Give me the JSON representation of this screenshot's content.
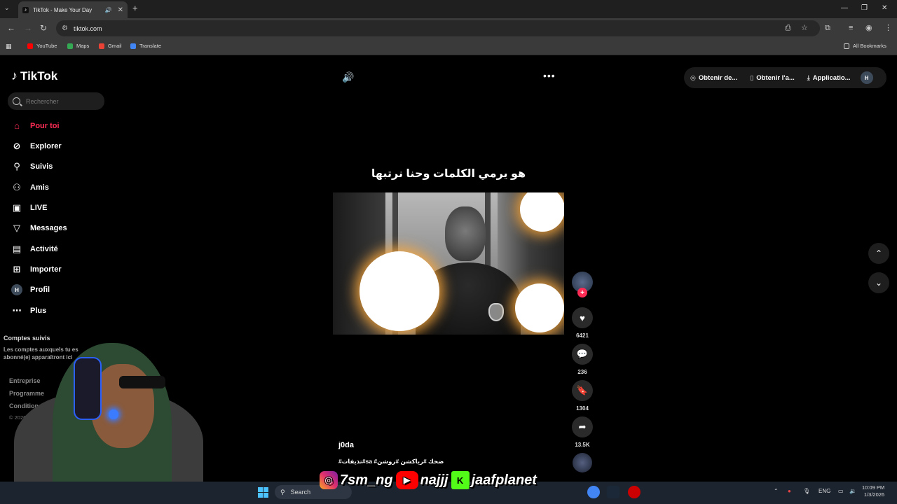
{
  "browser": {
    "tab_title": "TikTok - Make Your Day",
    "url": "tiktok.com",
    "bookmarks": [
      {
        "label": "YouTube",
        "color": "#ff0000"
      },
      {
        "label": "Maps",
        "color": "#34a853"
      },
      {
        "label": "Gmail",
        "color": "#ea4335"
      },
      {
        "label": "Translate",
        "color": "#4285f4"
      }
    ],
    "all_bookmarks": "All Bookmarks"
  },
  "tiktok": {
    "brand": "TikTok",
    "search_placeholder": "Rechercher",
    "nav": [
      {
        "label": "Pour toi",
        "icon": "home-icon",
        "active": true
      },
      {
        "label": "Explorer",
        "icon": "compass-icon"
      },
      {
        "label": "Suivis",
        "icon": "user-follow-icon"
      },
      {
        "label": "Amis",
        "icon": "friends-icon"
      },
      {
        "label": "LIVE",
        "icon": "live-icon"
      },
      {
        "label": "Messages",
        "icon": "messages-icon"
      },
      {
        "label": "Activité",
        "icon": "activity-icon"
      },
      {
        "label": "Importer",
        "icon": "upload-icon"
      },
      {
        "label": "Profil",
        "icon": "profile-avatar",
        "avatar_letter": "H"
      },
      {
        "label": "Plus",
        "icon": "more-icon"
      }
    ],
    "followed_title": "Comptes suivis",
    "followed_desc": "Les comptes auxquels tu es abonné(e) apparaîtront ici",
    "footer_links": [
      "Entreprise",
      "Programme",
      "Conditions générales"
    ],
    "copyright": "© 2026 TikTok",
    "topbar": {
      "get_coins": "Obtenir de...",
      "get_app": "Obtenir l'a...",
      "application": "Applicatio...",
      "avatar_letter": "H"
    },
    "video": {
      "caption_overlay": "هو يرمي الكلمات وحنا نرتبها",
      "author": "j0da",
      "hashtags": "#تذيفات#sa #ضحك #رياكشن #روشن",
      "likes": "6421",
      "comments": "236",
      "saves": "1304",
      "shares": "13.5K"
    }
  },
  "overlay": {
    "instagram": "7sm_ng",
    "youtube": "najjj",
    "kick": "jaafplanet"
  },
  "taskbar": {
    "search": "Search",
    "lang": "ENG",
    "time": "10:09 PM",
    "date": "1/3/2026"
  }
}
